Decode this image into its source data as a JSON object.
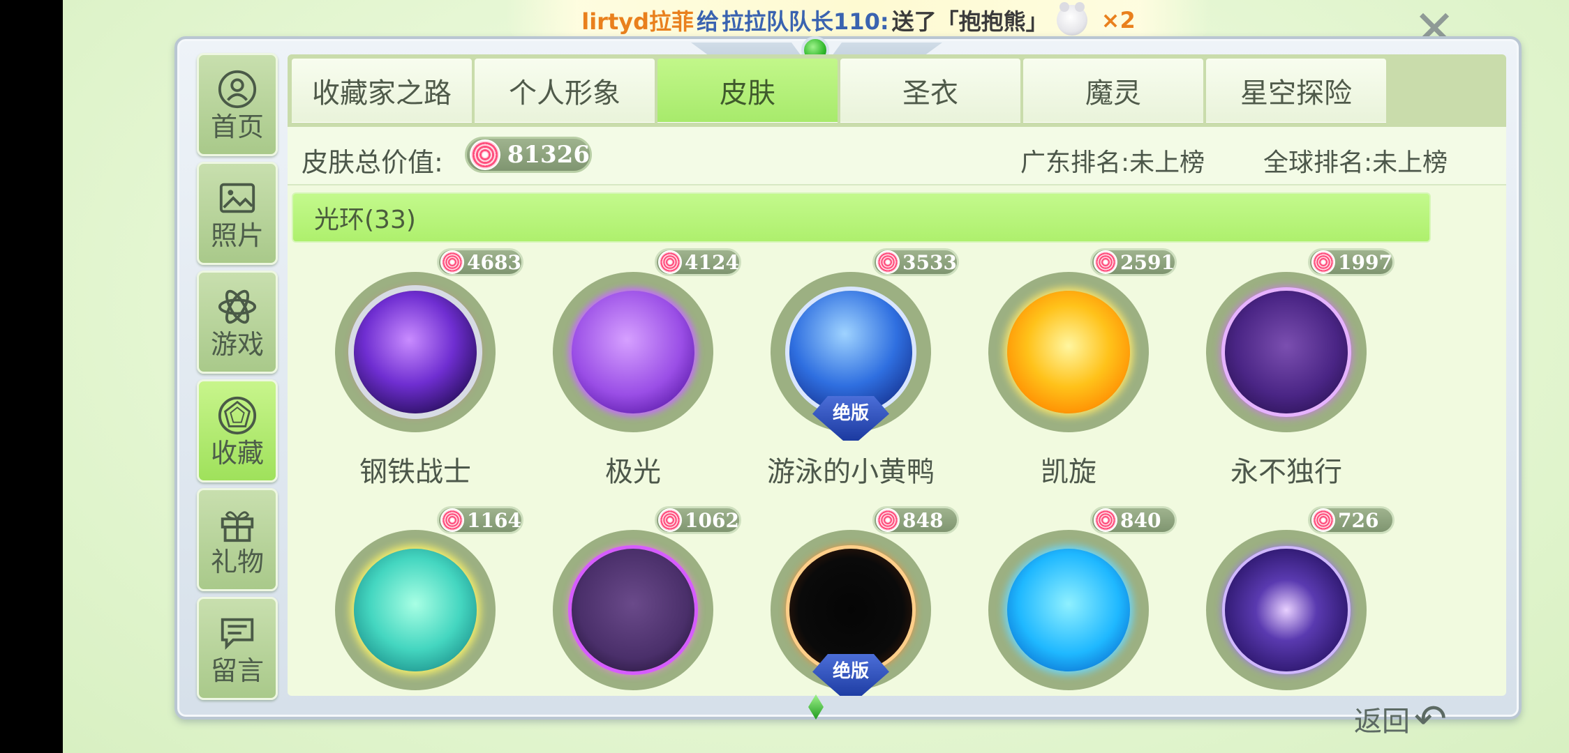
{
  "banner": {
    "user": "lirtyd拉菲",
    "connector1": "给",
    "target": "拉拉队队长110:",
    "action": "送了「抱抱熊」",
    "count": "×2",
    "gift_icon": "teddy-bear-icon"
  },
  "close_icon": "✕",
  "sidebar": {
    "items": [
      {
        "label": "首页",
        "icon": "home-icon",
        "active": false
      },
      {
        "label": "照片",
        "icon": "photo-icon",
        "active": false
      },
      {
        "label": "游戏",
        "icon": "atom-icon",
        "active": false
      },
      {
        "label": "收藏",
        "icon": "gem-icon",
        "active": true
      },
      {
        "label": "礼物",
        "icon": "gift-icon",
        "active": false
      },
      {
        "label": "留言",
        "icon": "message-icon",
        "active": false
      }
    ]
  },
  "tabs": [
    {
      "label": "收藏家之路",
      "active": false
    },
    {
      "label": "个人形象",
      "active": false
    },
    {
      "label": "皮肤",
      "active": true
    },
    {
      "label": "圣衣",
      "active": false
    },
    {
      "label": "魔灵",
      "active": false
    },
    {
      "label": "星空探险",
      "active": false
    }
  ],
  "summary": {
    "label": "皮肤总价值:",
    "value": "81326",
    "rank_guangdong": "广东排名:未上榜",
    "rank_global": "全球排名:未上榜"
  },
  "section": {
    "title": "光环(33)"
  },
  "items": [
    {
      "name": "钢铁战士",
      "price": "4683",
      "badge": ""
    },
    {
      "name": "极光",
      "price": "4124",
      "badge": ""
    },
    {
      "name": "游泳的小黄鸭",
      "price": "3533",
      "badge": "绝版"
    },
    {
      "name": "凯旋",
      "price": "2591",
      "badge": ""
    },
    {
      "name": "永不独行",
      "price": "1997",
      "badge": ""
    },
    {
      "name": "",
      "price": "1164",
      "badge": ""
    },
    {
      "name": "",
      "price": "1062",
      "badge": ""
    },
    {
      "name": "",
      "price": "848",
      "badge": "绝版"
    },
    {
      "name": "",
      "price": "840",
      "badge": ""
    },
    {
      "name": "",
      "price": "726",
      "badge": ""
    }
  ],
  "back": {
    "label": "返回",
    "icon": "back-arrow-icon"
  },
  "colors": {
    "accent_green": "#aef06d",
    "candy_pink": "#ff4f7e",
    "badge_blue": "#2a4cc0"
  }
}
